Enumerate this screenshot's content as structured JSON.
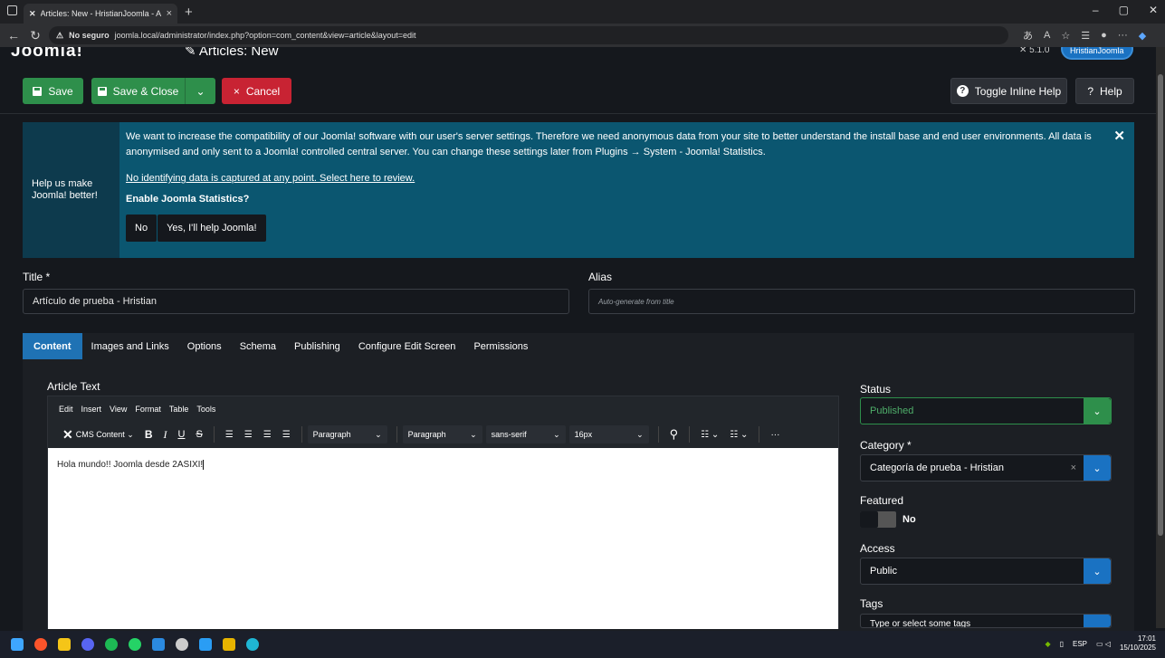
{
  "browser": {
    "tab_title": "Articles: New - HristianJoomla - A",
    "url_warning": "No seguro",
    "url": "joomla.local/administrator/index.php?option=com_content&view=article&layout=edit",
    "new_tab": "+",
    "tab_close": "×"
  },
  "header": {
    "logo": "Joomla!",
    "page_title": "Articles: New",
    "version": "5.1.0",
    "user": "HristianJoomla"
  },
  "toolbar": {
    "save": "Save",
    "save_close": "Save & Close",
    "cancel": "Cancel",
    "toggle_help": "Toggle Inline Help",
    "help": "Help",
    "dropdown_caret": "⌄",
    "close_icon": "×",
    "question_icon": "?"
  },
  "stats": {
    "side": "Help us make Joomla! better!",
    "message": "We want to increase the compatibility of our Joomla! software with our user's server settings. Therefore we need anonymous data from your site to better understand the install base and end user environments. All data is anonymised and only sent to a Joomla! controlled central server. You can change these settings later from Plugins → System - Joomla! Statistics.",
    "link": "No identifying data is captured at any point. Select here to review.",
    "question": "Enable Joomla Statistics?",
    "btn_no": "No",
    "btn_yes": "Yes, I'll help Joomla!",
    "close": "✕"
  },
  "form": {
    "title_label": "Title *",
    "title_value": "Artículo de prueba - Hristian",
    "alias_label": "Alias",
    "alias_placeholder": "Auto-generate from title"
  },
  "tabs": [
    "Content",
    "Images and Links",
    "Options",
    "Schema",
    "Publishing",
    "Configure Edit Screen",
    "Permissions"
  ],
  "editor": {
    "label": "Article Text",
    "menu": [
      "Edit",
      "Insert",
      "View",
      "Format",
      "Table",
      "Tools"
    ],
    "cms_content": "CMS Content",
    "format1": "Paragraph",
    "format2": "Paragraph",
    "font": "sans-serif",
    "size": "16px",
    "bold": "B",
    "italic": "I",
    "underline": "U",
    "strike": "S",
    "more": "···",
    "content": "Hola mundo!! Joomla desde 2ASIXI!"
  },
  "sidebar": {
    "status_label": "Status",
    "status_value": "Published",
    "category_label": "Category *",
    "category_value": "Categoría de prueba - Hristian",
    "clear": "×",
    "featured_label": "Featured",
    "featured_value": "No",
    "access_label": "Access",
    "access_value": "Public",
    "tags_label": "Tags",
    "tags_placeholder": "Type or select some tags",
    "dropdown_caret": "⌄"
  },
  "taskbar": {
    "lang": "ESP",
    "time": "17:01",
    "date": "15/10/2025"
  },
  "colors": {
    "green": "#2e8f4b",
    "red": "#c82333",
    "blue": "#1f72b4",
    "banner": "#0b5670"
  }
}
